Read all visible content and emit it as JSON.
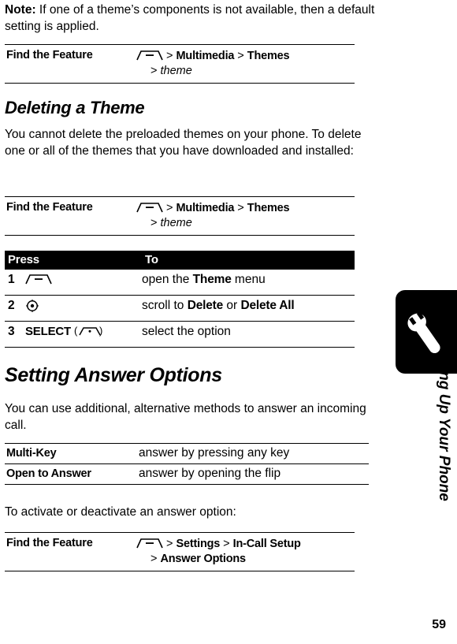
{
  "note": {
    "label": "Note:",
    "text": " If one of a theme’s components is not available, then a default setting is applied."
  },
  "find_feature_1": {
    "label": "Find the Feature",
    "menu_icon": "menu-key-icon",
    "path_part1": "> ",
    "item1": "Multimedia",
    "sep1": " > ",
    "item2": "Themes",
    "path_part2": "> ",
    "item3": "theme"
  },
  "section_deleting": {
    "heading": "Deleting a Theme",
    "paragraph": "You cannot delete the preloaded themes on your phone. To delete one or all of the themes that you have downloaded and installed:"
  },
  "find_feature_2": {
    "label": "Find the Feature",
    "menu_icon": "menu-key-icon",
    "path_part1": "> ",
    "item1": "Multimedia",
    "sep1": " > ",
    "item2": "Themes",
    "path_part2": "> ",
    "item3": "theme"
  },
  "press_table": {
    "header": {
      "press": "Press",
      "to": "To"
    },
    "rows": [
      {
        "num": "1",
        "key_icon": "menu-key-icon",
        "key_label": "",
        "to_pre": "open the ",
        "to_bold": "Theme",
        "to_post": " menu"
      },
      {
        "num": "2",
        "key_icon": "navigation-key-icon",
        "key_label": "",
        "to_pre": "scroll to ",
        "to_bold": "Delete",
        "to_mid": " or ",
        "to_bold2": "Delete All",
        "to_post": ""
      },
      {
        "num": "3",
        "key_icon": "softkey-icon",
        "key_label": "SELECT",
        "to_pre": "select the option",
        "to_bold": "",
        "to_post": ""
      }
    ]
  },
  "section_answer": {
    "heading": "Setting Answer Options",
    "paragraph": "You can use additional, alternative methods to answer an incoming call.",
    "options": [
      {
        "name": "Multi-Key",
        "desc": "answer by pressing any key"
      },
      {
        "name": "Open to Answer",
        "desc": "answer by opening the flip"
      }
    ],
    "activate_text": "To activate or deactivate an answer option:"
  },
  "find_feature_3": {
    "label": "Find the Feature",
    "menu_icon": "menu-key-icon",
    "path_part1": "> ",
    "item1": "Settings",
    "sep1": " > ",
    "item2": "In-Call Setup",
    "path_part2": "> ",
    "item3": "Answer Options"
  },
  "sidebar": {
    "title": "Setting Up Your Phone",
    "page_number": "59",
    "tab_icon": "wrench-icon"
  }
}
